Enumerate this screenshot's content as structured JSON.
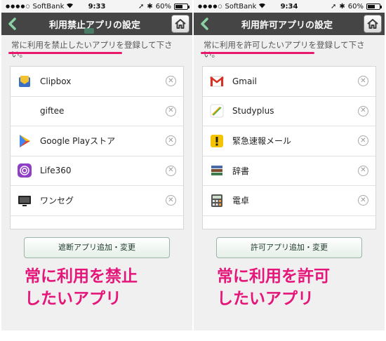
{
  "left": {
    "status": {
      "carrier": "SoftBank",
      "time": "9:33",
      "battery": "60%"
    },
    "title": "利用禁止アプリの設定",
    "instruction": "常に利用を禁止したいアプリを登録して下さい。",
    "apps": [
      {
        "name": "Clipbox",
        "icon": "clipbox-icon"
      },
      {
        "name": "giftee",
        "icon": "giftee-icon"
      },
      {
        "name": "Google Playストア",
        "icon": "google-play-icon"
      },
      {
        "name": "Life360",
        "icon": "life360-icon"
      },
      {
        "name": "ワンセグ",
        "icon": "tv-icon"
      }
    ],
    "button": "遮断アプリ追加・変更",
    "caption": "常に利用を禁止したいアプリ"
  },
  "right": {
    "status": {
      "carrier": "SoftBank",
      "time": "9:34",
      "battery": "60%"
    },
    "title": "利用許可アプリの設定",
    "instruction": "常に利用を許可したいアプリを登録して下さい。",
    "apps": [
      {
        "name": "Gmail",
        "icon": "gmail-icon"
      },
      {
        "name": "Studyplus",
        "icon": "studyplus-icon"
      },
      {
        "name": "緊急速報メール",
        "icon": "emergency-alert-icon"
      },
      {
        "name": "辞書",
        "icon": "dictionary-icon"
      },
      {
        "name": "電卓",
        "icon": "calculator-icon"
      }
    ],
    "button": "許可アプリ追加・変更",
    "caption": "常に利用を許可したいアプリ"
  },
  "colors": {
    "navbar": "#454545",
    "accent": "#8ad1a3",
    "caption": "#e5157a"
  }
}
